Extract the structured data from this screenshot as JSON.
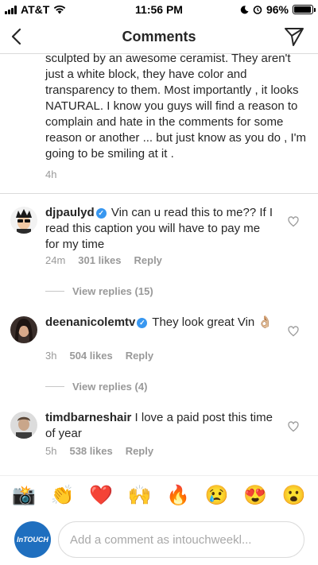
{
  "status_bar": {
    "carrier": "AT&T",
    "time": "11:56 PM",
    "battery": "96%",
    "battery_level": 0.96
  },
  "header": {
    "title": "Comments",
    "back_icon": "chevron-left-icon",
    "send_icon": "paper-plane-icon"
  },
  "caption": {
    "text": "sculpted by an awesome ceramist. They aren't just a white block, they have color and transparency to them. Most importantly , it looks NATURAL. I know you guys will find a reason to complain and hate in the comments for some reason or another ... but just know as you do , I'm going to be smiling at it .",
    "time": "4h"
  },
  "comments": [
    {
      "username": "djpaulyd",
      "text": "Vin can u read this to me?? If I read this caption you will have to pay me for my time",
      "time": "24m",
      "likes": "301 likes",
      "reply": "Reply",
      "view_replies": "View replies (15)"
    },
    {
      "username": "deenanicolemtv",
      "text": "They look great Vin 👌🏼",
      "time": "3h",
      "likes": "504 likes",
      "reply": "Reply",
      "view_replies": "View replies (4)"
    },
    {
      "username": "timdbarneshair",
      "text": "I love a paid post this time of year",
      "time": "5h",
      "likes": "538 likes",
      "reply": "Reply"
    }
  ],
  "emoji_bar": [
    "📸",
    "👏",
    "❤️",
    "🙌",
    "🔥",
    "😢",
    "😍",
    "😮"
  ],
  "composer": {
    "avatar_text": "InTOUCH",
    "placeholder": "Add a comment as intouchweekl..."
  },
  "colors": {
    "verified": "#3897f0",
    "meta_gray": "#999999",
    "text": "#262626"
  }
}
